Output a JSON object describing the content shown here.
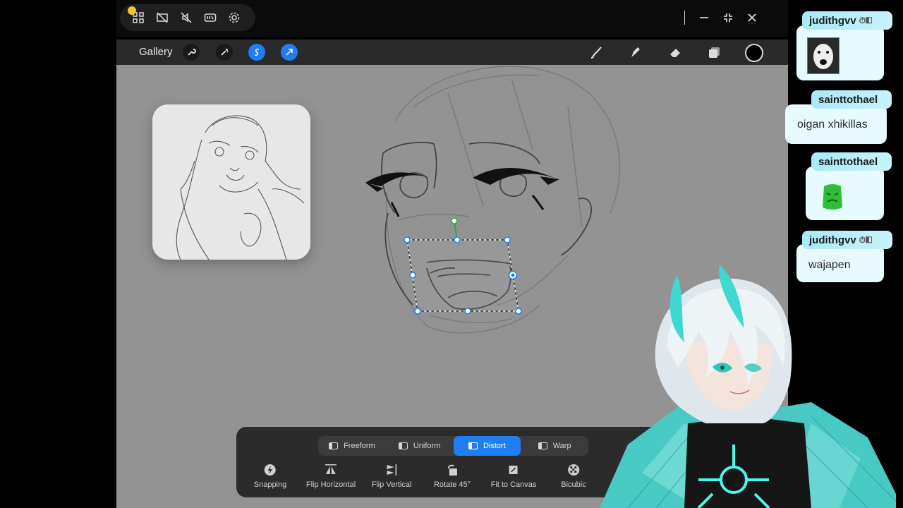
{
  "window": {
    "system_icons": [
      "apps-icon",
      "screen-off-icon",
      "mute-icon",
      "hdr-icon",
      "settings-icon"
    ],
    "controls": [
      "minimize-icon",
      "restore-icon",
      "close-icon"
    ]
  },
  "app": {
    "gallery_label": "Gallery",
    "left_tools": [
      "wrench-icon",
      "magic-wand-icon",
      "selection-icon",
      "transform-arrow-icon"
    ],
    "right_tools": [
      "brush-icon",
      "smudge-icon",
      "eraser-icon",
      "layers-icon"
    ],
    "current_color": "#000000"
  },
  "transform": {
    "modes": [
      {
        "label": "Freeform",
        "active": false
      },
      {
        "label": "Uniform",
        "active": false
      },
      {
        "label": "Distort",
        "active": true
      },
      {
        "label": "Warp",
        "active": false
      }
    ],
    "tools": [
      {
        "label": "Snapping",
        "icon": "lightning-icon"
      },
      {
        "label": "Flip Horizontal",
        "icon": "flip-horizontal-icon"
      },
      {
        "label": "Flip Vertical",
        "icon": "flip-vertical-icon"
      },
      {
        "label": "Rotate 45°",
        "icon": "rotate-icon"
      },
      {
        "label": "Fit to Canvas",
        "icon": "fit-canvas-icon"
      },
      {
        "label": "Bicubic",
        "icon": "bicubic-icon"
      }
    ]
  },
  "chat": {
    "messages": [
      {
        "user": "judithgvv",
        "text": "",
        "emote": "dog-emote"
      },
      {
        "user": "sainttothael",
        "text": "oigan xhikillas",
        "emote": ""
      },
      {
        "user": "sainttothael",
        "text": "",
        "emote": "green-sick-emote"
      },
      {
        "user": "judithgvv",
        "text": "wajapen",
        "emote": ""
      }
    ]
  },
  "colors": {
    "accent": "#1f7ef2",
    "chip": "#a8e9f7",
    "bubble": "#e7fbff",
    "canvas": "#939393"
  }
}
